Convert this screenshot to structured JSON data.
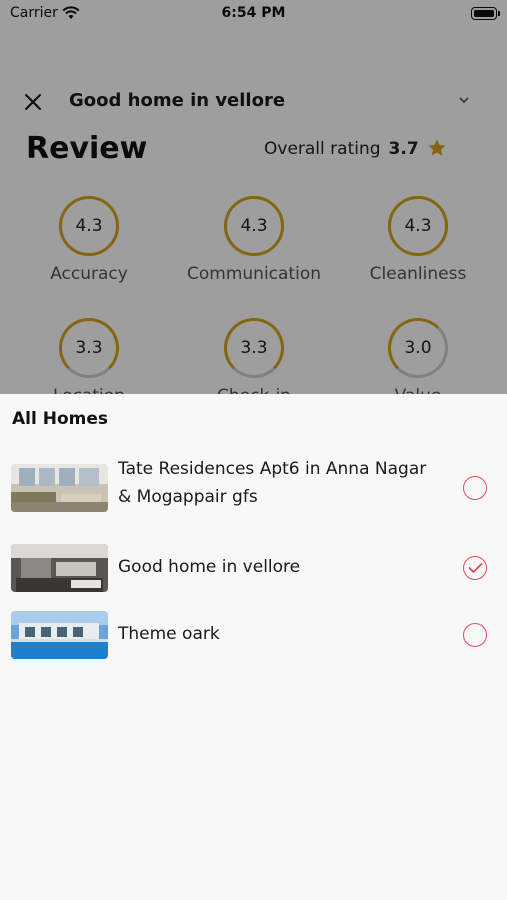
{
  "status_bar": {
    "carrier": "Carrier",
    "time": "6:54 PM"
  },
  "header": {
    "home_name": "Good home in vellore"
  },
  "review": {
    "title": "Review",
    "overall_label": "Overall rating",
    "overall_value": "3.7",
    "ratings": [
      {
        "label": "Accuracy",
        "value": "4.3"
      },
      {
        "label": "Communication",
        "value": "4.3"
      },
      {
        "label": "Cleanliness",
        "value": "4.3"
      },
      {
        "label": "Location",
        "value": "3.3"
      },
      {
        "label": "Check-in",
        "value": "3.3"
      },
      {
        "label": "Value",
        "value": "3.0"
      }
    ]
  },
  "sheet": {
    "title": "All Homes",
    "homes": [
      {
        "name": "Tate Residences Apt6 in Anna Nagar & Mogappair gfs",
        "selected": false
      },
      {
        "name": "Good home in vellore",
        "selected": true
      },
      {
        "name": "Theme oark",
        "selected": false
      }
    ]
  },
  "colors": {
    "accent_ring": "#d9a21b",
    "radio": "#e04b55",
    "overlay": "rgba(0,0,0,0.38)"
  }
}
